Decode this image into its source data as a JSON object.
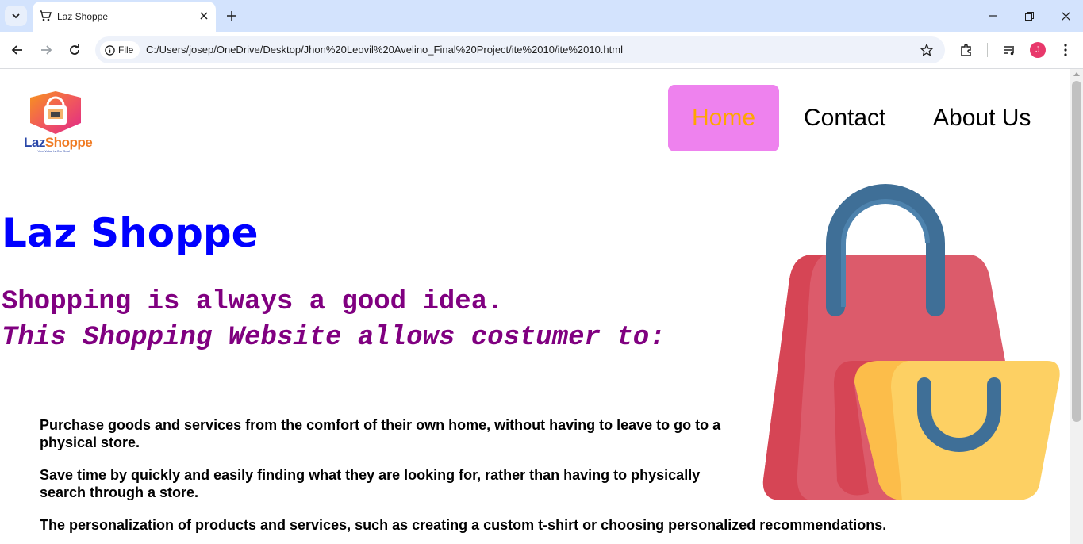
{
  "browser": {
    "tab_title": "Laz Shoppe",
    "chip_label": "File",
    "url": "C:/Users/josep/OneDrive/Desktop/Jhon%20Leovil%20Avelino_Final%20Project/ite%2010/ite%2010.html",
    "avatar_letter": "J"
  },
  "logo": {
    "text_part1": "Laz",
    "text_part2": "Shoppe",
    "tagline": "Your Value Is Our Goal"
  },
  "nav": {
    "home": "Home",
    "contact": "Contact",
    "about": "About Us"
  },
  "hero": {
    "title": "Laz Shoppe",
    "line1": "Shopping is always a good idea.",
    "line2": "This Shopping Website allows costumer to:"
  },
  "features": [
    "Purchase goods and services from the comfort of their own home, without having to leave to go to a physical store.",
    "Save time by quickly and easily finding what they are looking for, rather than having to physically search through a store.",
    "The personalization of products and services, such as creating a custom t-shirt or choosing personalized recommendations."
  ],
  "colors": {
    "title": "#0000ff",
    "tagline": "#800080",
    "home_bg": "#ee82ee",
    "home_text": "#ffa500"
  }
}
